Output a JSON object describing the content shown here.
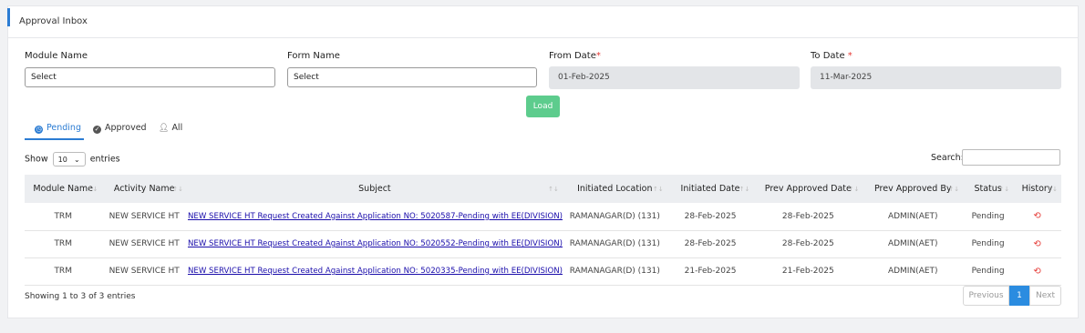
{
  "header": {
    "title": "Approval Inbox"
  },
  "filters": {
    "module_label": "Module Name",
    "module_value": "Select",
    "form_label": "Form Name",
    "form_value": "Select",
    "from_label": "From Date",
    "from_value": "01-Feb-2025",
    "to_label": "To Date",
    "to_value": "11-Mar-2025",
    "required_mark": "*",
    "load_label": "Load"
  },
  "tabs": [
    {
      "label": "Pending",
      "icon": "clock-icon"
    },
    {
      "label": "Approved",
      "icon": "check-circle-icon"
    },
    {
      "label": "All",
      "icon": "user-icon"
    }
  ],
  "table_controls": {
    "show_label": "Show",
    "entries_value": "10",
    "entries_label": "entries",
    "search_label": "Search:"
  },
  "table": {
    "columns": [
      "Module Name",
      "Activity Name",
      "Subject",
      "Initiated Location",
      "Initiated Date",
      "Prev Approved Date",
      "Prev Approved By",
      "Status",
      "History"
    ],
    "rows": [
      [
        "TRM",
        "NEW SERVICE HT",
        "NEW SERVICE HT Request Created Against Application NO: 5020587-Pending with EE(DIVISION)",
        "RAMANAGAR(D) (131)",
        "28-Feb-2025",
        "28-Feb-2025",
        "ADMIN(AET)",
        "Pending"
      ],
      [
        "TRM",
        "NEW SERVICE HT",
        "NEW SERVICE HT Request Created Against Application NO: 5020552-Pending with EE(DIVISION)",
        "RAMANAGAR(D) (131)",
        "28-Feb-2025",
        "28-Feb-2025",
        "ADMIN(AET)",
        "Pending"
      ],
      [
        "TRM",
        "NEW SERVICE HT",
        "NEW SERVICE HT Request Created Against Application NO: 5020335-Pending with EE(DIVISION)",
        "RAMANAGAR(D) (131)",
        "21-Feb-2025",
        "21-Feb-2025",
        "ADMIN(AET)",
        "Pending"
      ]
    ]
  },
  "footer": {
    "info": "Showing 1 to 3 of 3 entries",
    "prev": "Previous",
    "page": "1",
    "next": "Next"
  },
  "colors": {
    "accent": "#2b7cd3",
    "load_button": "#5dcc8d",
    "history_icon": "#e53935"
  }
}
